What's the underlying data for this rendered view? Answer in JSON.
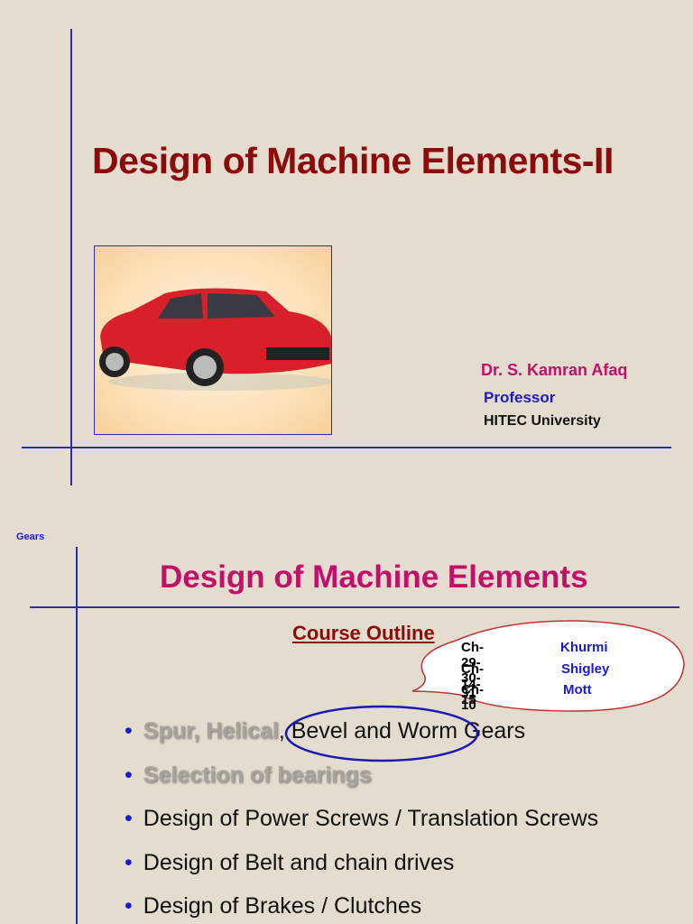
{
  "slide1": {
    "title": "Design of Machine Elements-II",
    "author": "Dr. S. Kamran Afaq",
    "role": "Professor",
    "university": "HITEC University"
  },
  "slide2": {
    "header_label": "Gears",
    "title": "Design of Machine Elements",
    "subtitle": "Course Outline",
    "references": [
      {
        "chapters": "Ch-29-30-31",
        "book": "Khurmi"
      },
      {
        "chapters": "Ch-14-15",
        "book": "Shigley"
      },
      {
        "chapters": "Ch-10",
        "book": "Mott"
      }
    ],
    "bullets": {
      "b1_dim": "Spur, Helical",
      "b1_rest_a": ", Bevel and Worm",
      "b1_rest_b": " Gears",
      "b2": "Selection of bearings",
      "b3": "Design of Power Screws / Translation Screws",
      "b4": "Design of Belt and chain drives",
      "b5": "Design of Brakes / Clutches"
    }
  },
  "colors": {
    "title_dark": "#8b0a0a",
    "magenta": "#c0106a",
    "blue": "#1a1ad0"
  }
}
